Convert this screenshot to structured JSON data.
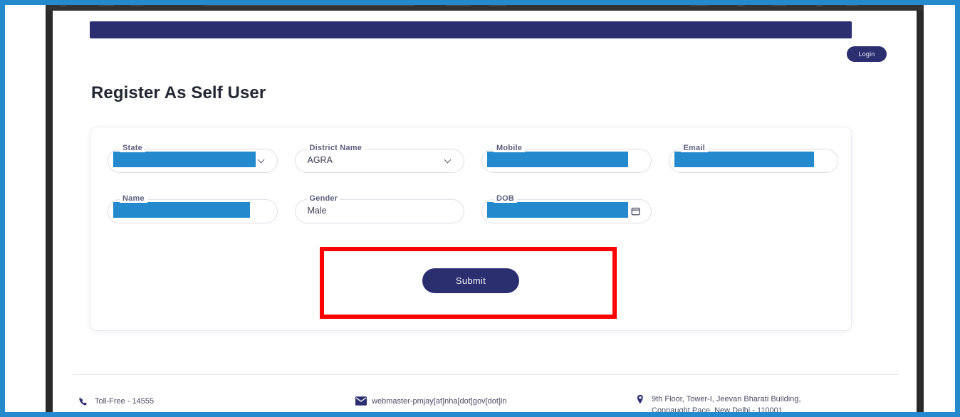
{
  "annotation": {
    "highlight_color": "#fd0000",
    "target": "submit-button"
  },
  "theme": {
    "navy": "#2b2f70",
    "accent_blue": "#2589ce",
    "redaction_blue": "#2589ce",
    "border_blue": "#2589ce"
  },
  "header": {
    "login_label": "Login"
  },
  "page": {
    "title": "Register As Self User"
  },
  "form": {
    "fields": [
      {
        "label": "State",
        "value": "",
        "redacted": true,
        "redaction_width": 200,
        "control": "select"
      },
      {
        "label": "District Name",
        "value": "AGRA",
        "redacted": false,
        "control": "select"
      },
      {
        "label": "Mobile",
        "value": "",
        "redacted": true,
        "redaction_width": 198,
        "control": "text"
      },
      {
        "label": "Email",
        "value": "",
        "redacted": true,
        "redaction_width": 196,
        "control": "text"
      },
      {
        "label": "Name",
        "value": "",
        "redacted": true,
        "redaction_width": 192,
        "control": "text"
      },
      {
        "label": "Gender",
        "value": "Male",
        "redacted": false,
        "control": "text"
      },
      {
        "label": "DOB",
        "value": "",
        "redacted": true,
        "redaction_width": 198,
        "control": "date"
      }
    ],
    "submit_label": "Submit"
  },
  "footer": {
    "phone": "Toll-Free - 14555",
    "email": "webmaster-pmjay[at]nha[dot]gov[dot]in",
    "address": "9th Floor, Tower-I, Jeevan Bharati Building,\nConnaught Pace, New Delhi - 110001"
  }
}
